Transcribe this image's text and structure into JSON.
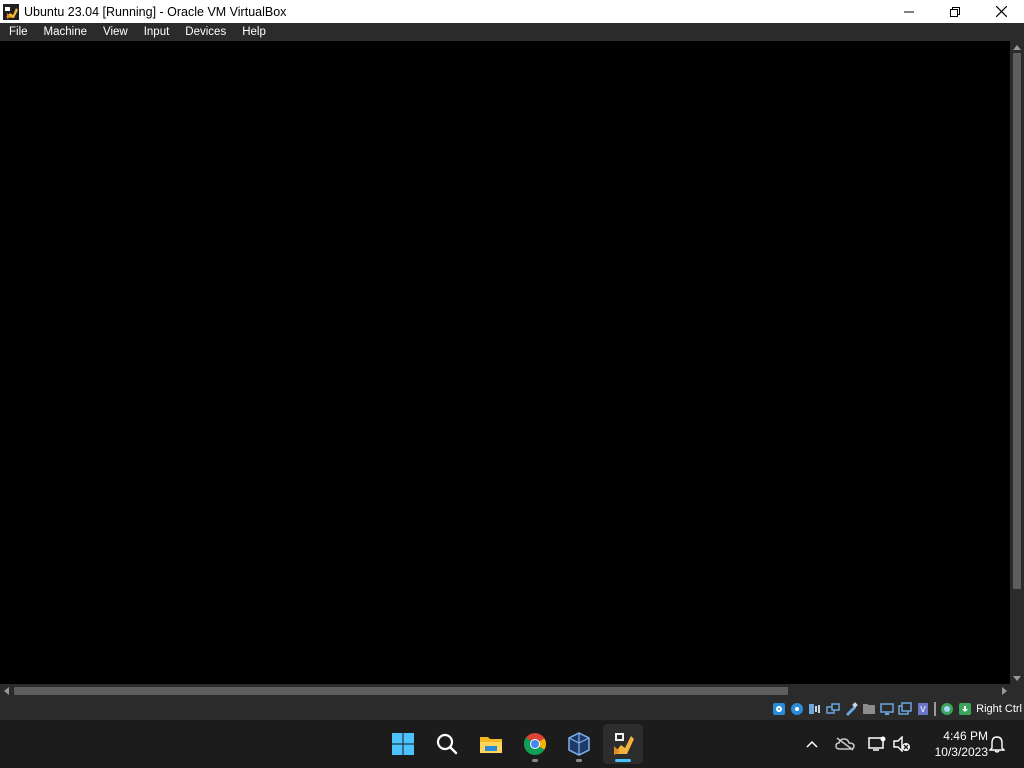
{
  "window": {
    "title": "Ubuntu 23.04 [Running] - Oracle VM VirtualBox",
    "controls": [
      "minimize",
      "maximize",
      "close"
    ]
  },
  "menu": {
    "items": [
      "File",
      "Machine",
      "View",
      "Input",
      "Devices",
      "Help"
    ]
  },
  "statusbar": {
    "icons": [
      "hard-disk-icon",
      "optical-drive-icon",
      "audio-icon",
      "network-icon",
      "usb-icon",
      "shared-folders-icon",
      "display-icon",
      "video-capture-icon",
      "virtualization-icon",
      "guest-additions-icon",
      "mouse-integration-icon",
      "keyboard-capture-icon"
    ],
    "host_key": "Right Ctrl"
  },
  "taskbar": {
    "apps": [
      "start-icon",
      "search-icon",
      "file-explorer-icon",
      "chrome-icon",
      "virtualbox-manager-icon",
      "virtualbox-vm-icon"
    ],
    "tray": [
      "show-hidden-icons-chevron",
      "onedrive-icon",
      "network-icon",
      "volume-muted-icon",
      "notifications-icon"
    ],
    "time": "4:46 PM",
    "date": "10/3/2023"
  },
  "colors": {
    "accent": "#4cc2ff",
    "menubar": "#2b2b2b",
    "taskbar": "#1c1c1c"
  }
}
